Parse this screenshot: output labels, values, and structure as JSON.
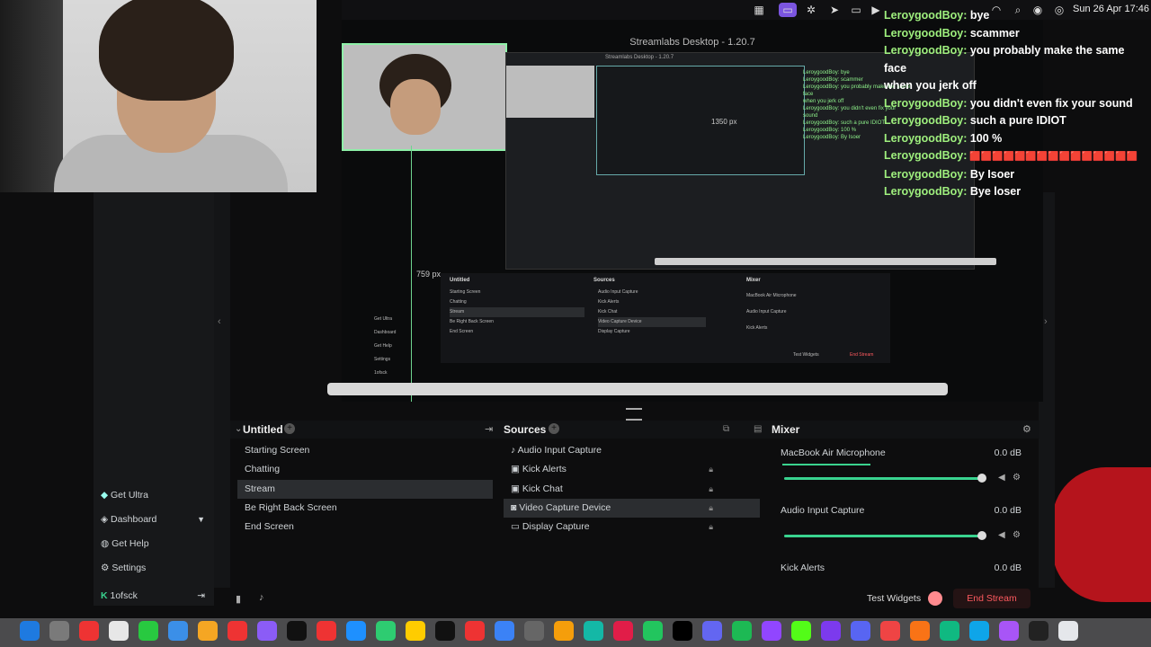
{
  "window": {
    "app_title": "Streamlabs Desktop - 1.20.7",
    "clock": "Sun 26 Apr  17:46"
  },
  "preview": {
    "mini_title": "Streamlabs Desktop - 1.20.7",
    "dimension_label_width": "1350 px",
    "dimension_label_height": "759 px",
    "mini_scenes_title": "Untitled",
    "mini_scenes": [
      "Starting Screen",
      "Chatting",
      "Stream",
      "Be Right Back Screen",
      "End Screen"
    ],
    "mini_sources_title": "Sources",
    "mini_sources": [
      "Audio Input Capture",
      "Kick Alerts",
      "Kick Chat",
      "Video Capture Device",
      "Display Capture"
    ],
    "mini_mixer_title": "Mixer",
    "mini_mixer": [
      "MacBook Air Microphone",
      "Audio Input Capture",
      "Kick Alerts"
    ],
    "mini_nav": [
      "Get Ultra",
      "Dashboard",
      "Get Help",
      "Settings",
      "1ofsck"
    ],
    "mini_test_widgets": "Test Widgets",
    "mini_end_stream": "End Stream",
    "mini_chat": [
      "LeroygoodBoy: bye",
      "LeroygoodBoy: scammer",
      "LeroygoodBoy: you probably make the same face",
      "when you jerk off",
      "LeroygoodBoy: you didn't even fix your sound",
      "LeroygoodBoy: such a pure IDIOT",
      "LeroygoodBoy: 100 %",
      "LeroygoodBoy: By Isoer"
    ]
  },
  "chat": [
    {
      "user": "LeroygoodBoy:",
      "text": "bye"
    },
    {
      "user": "LeroygoodBoy:",
      "text": "scammer"
    },
    {
      "user": "LeroygoodBoy:",
      "text": "you probably make the same face"
    },
    {
      "user": "",
      "text": "when you jerk off"
    },
    {
      "user": "LeroygoodBoy:",
      "text": "you didn't even fix your sound"
    },
    {
      "user": "LeroygoodBoy:",
      "text": "such a pure IDIOT"
    },
    {
      "user": "LeroygoodBoy:",
      "text": "100 %"
    },
    {
      "user": "LeroygoodBoy:",
      "text": "🟥🟥🟥🟥🟥🟥🟥🟥🟥🟥🟥🟥🟥🟥🟥"
    },
    {
      "user": "LeroygoodBoy:",
      "text": "By Isoer"
    },
    {
      "user": "LeroygoodBoy:",
      "text": "Bye loser"
    }
  ],
  "scenes": {
    "title": "Untitled",
    "items": [
      "Starting Screen",
      "Chatting",
      "Stream",
      "Be Right Back Screen",
      "End Screen"
    ],
    "selected": "Stream"
  },
  "sources": {
    "title": "Sources",
    "items": [
      "Audio Input Capture",
      "Kick Alerts",
      "Kick Chat",
      "Video Capture Device",
      "Display Capture"
    ],
    "selected": "Video Capture Device"
  },
  "mixer": {
    "title": "Mixer",
    "channels": [
      {
        "name": "MacBook Air Microphone",
        "db": "0.0 dB",
        "volume": 1.0
      },
      {
        "name": "Audio Input Capture",
        "db": "0.0 dB",
        "volume": 1.0
      },
      {
        "name": "Kick Alerts",
        "db": "0.0 dB"
      }
    ]
  },
  "nav": {
    "get_ultra": "Get Ultra",
    "dashboard": "Dashboard",
    "get_help": "Get Help",
    "settings": "Settings",
    "account": "1ofsck"
  },
  "footer": {
    "test_widgets": "Test Widgets",
    "end_stream": "End Stream"
  },
  "icons": {
    "collapse": "chevron-left-icon",
    "add": "plus-icon",
    "settings": "gear-icon",
    "lock": "lock-icon"
  },
  "colors": {
    "accent_green": "#39d38f",
    "chat_user": "#9ff07e",
    "end_stream_red": "#ff5a5f",
    "selection": "#2b2d30"
  }
}
